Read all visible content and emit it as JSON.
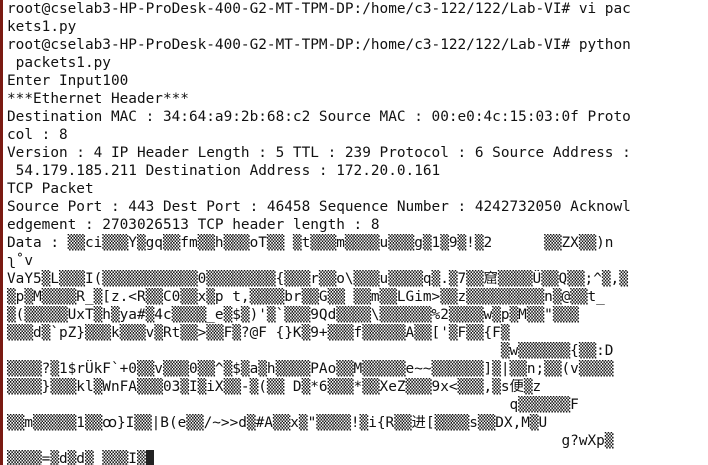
{
  "terminal": {
    "lines": [
      "root@cselab3-HP-ProDesk-400-G2-MT-TPM-DP:/home/c3-122/122/Lab-VI# vi pac",
      "kets1.py",
      "root@cselab3-HP-ProDesk-400-G2-MT-TPM-DP:/home/c3-122/122/Lab-VI# python",
      " packets1.py",
      "Enter Input100",
      "***Ethernet Header***",
      "Destination MAC : 34:64:a9:2b:68:c2 Source MAC : 00:e0:4c:15:03:0f Proto",
      "col : 8",
      "Version : 4 IP Header Length : 5 TTL : 239 Protocol : 6 Source Address :",
      " 54.179.185.211 Destination Address : 172.20.0.161",
      "TCP Packet",
      "Source Port : 443 Dest Port : 46458 Sequence Number : 4242732050 Acknowl",
      "edgement : 2703026513 TCP header length : 8",
      "Data : ▒▒ci▒▒▒Y▒gq▒▒fm▒▒h▒▒▒oT▒▒ ▒t▒▒▒m▒▒▒▒u▒▒▒g▒1▒9▒!▒2      ▒▒ZX▒▒)n",
      "ʅ˚v",
      "VaY5▒L▒▒▒I(▒▒▒▒▒▒▒▒▒▒▒0▒▒▒▒▒▒▒▒{▒▒▒r▒▒o\\▒▒▒u▒▒▒▒q▒.▒7▒▒窟▒▒▒▒Ü▒▒Q▒▒;^▒,▒",
      "▒p▒M▒▒▒▒R_▒[z.<R▒▒C0▒▒x▒p t,▒▒▒▒br▒▒G▒▒ ▒▒m▒▒LGim>▒▒z▒▒▒▒▒▒▒▒▒n▒@▒▒t_",
      "▒(▒▒▒▒▒UxT▒h▒ya#▒4c▒▒▒▒_e▒$▒)'▒`▒▒▒9Qd▒▒▒▒\\▒▒▒▒▒▒%2▒▒▒▒w▒p▒M▒▒\"▒▒▒",
      "▒▒▒d▒`pZ}▒▒▒k▒▒▒v▒Rt▒▒>▒▒F▒?@F {}K▒9+▒▒▒f▒▒▒▒▒A▒▒['▒F▒▒{F▒",
      "                                                         ▒w▒▒▒▒▒▒{▒▒:D",
      "▒▒▒▒?▒1$rÜkF`+0▒▒v▒▒▒0▒▒^▒$▒a▒h▒▒▒▒PAo▒▒M▒▒▒▒▒e~~▒▒▒▒▒▒]▒|▒▒n;▒▒(v▒▒▒▒",
      "▒▒▒▒}▒▒▒kl▒WnFA▒▒▒03▒I▒iX▒▒-▒(▒▒ D▒*6▒▒▒*▒▒XeZ▒▒▒9x<▒▒▒,▒s便▒z",
      "                                                          q▒▒▒▒▒▒F",
      "▒▒m▒▒▒▒▒1▒▒ꝏ}I▒▒|B(e▒▒/~>>d▒#A▒▒x▒\"▒▒▒▒!▒i{R▒▒进[▒▒▒▒s▒▒DX,M▒U",
      "                                                                g?wXp▒",
      "▒▒▒▒=▒d▒d▒ ▒▒▒I▒"
    ]
  }
}
